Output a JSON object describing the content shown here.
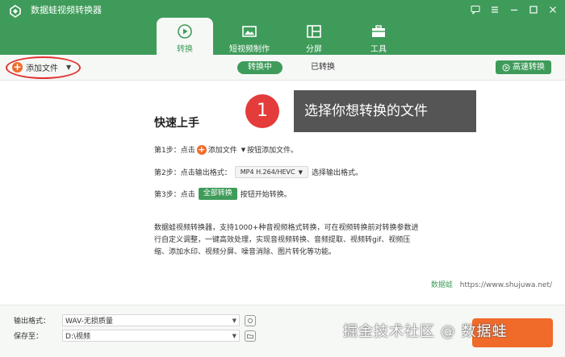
{
  "app": {
    "title": "数据蛙视频转换器",
    "accent": "#3f9b5a"
  },
  "window_controls": [
    "chat-icon",
    "menu-icon",
    "minimize-icon",
    "maximize-icon",
    "close-icon"
  ],
  "tabs": [
    {
      "label": "转换",
      "icon": "convert-icon",
      "active": true
    },
    {
      "label": "短视频制作",
      "icon": "short-video-icon",
      "active": false
    },
    {
      "label": "分屏",
      "icon": "split-screen-icon",
      "active": false
    },
    {
      "label": "工具",
      "icon": "toolbox-icon",
      "active": false
    }
  ],
  "toolbar": {
    "add_file": "添加文件",
    "seg_converting": "转换中",
    "seg_converted": "已转换",
    "high_speed": "高速转换"
  },
  "quick_start": {
    "title": "快速上手",
    "step1_prefix": "第1步：点击",
    "step1_button": "添加文件",
    "step1_suffix": "按钮添加文件。",
    "step2_prefix": "第2步：点击输出格式：",
    "step2_format": "MP4 H.264/HEVC",
    "step2_suffix": "选择输出格式。",
    "step3_prefix": "第3步：点击",
    "step3_button": "全部转换",
    "step3_suffix": "按钮开始转换。"
  },
  "description": "数据蛙视频转换器，支持1000+种音视频格式转换，可在视频转换前对转换参数进行自定义调整，一键高效处理，实现音视频转换、音频提取、视频转gif、视频压缩、添加水印、视频分屏、噪音消除、图片转化等功能。",
  "site": {
    "brand": "数据蛙",
    "url": "https://www.shujuwa.net/"
  },
  "callout": {
    "number": "1",
    "text": "选择你想转换的文件"
  },
  "bottom": {
    "output_label": "输出格式：",
    "output_value": "WAV-无损质量",
    "save_label": "保存至：",
    "save_value": "D:\\视频"
  },
  "watermark": "掘金技术社区 @ 数据蛙"
}
